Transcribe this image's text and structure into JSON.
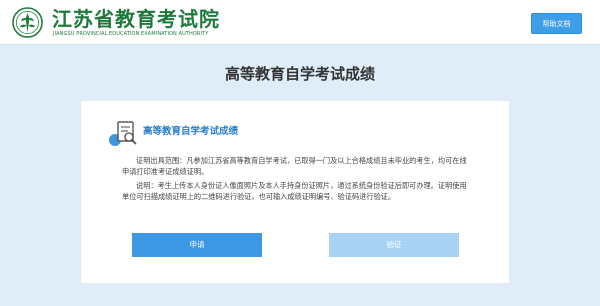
{
  "header": {
    "title": "江苏省教育考试院",
    "subtitle": "JIANGSU PROVINCIAL EDUCATION EXAMINATION AUTHORITY",
    "help_label": "帮助文档"
  },
  "page": {
    "title": "高等教育自学考试成绩"
  },
  "card": {
    "title": "高等教育自学考试成绩",
    "scope_text": "证明出具范围：凡参加江苏省高等教育自学考试，已取得一门及以上合格成绩且未毕业的考生，均可在线申请打印准考证成绩证明。",
    "note_text": "说明：考生上传本人身份证人像面照片及本人手持身份证照片，通过系统身份验证后即可办理。证明使用单位可扫描成绩证明上的二维码进行验证，也可输入成绩证明编号、验证码进行验证。"
  },
  "buttons": {
    "apply_label": "申请",
    "verify_label": "验证"
  },
  "colors": {
    "brand_green": "#1d7a3c",
    "accent_blue": "#3d97e2",
    "disabled_blue": "#a9d3f5",
    "background": "#deedf8"
  },
  "icons": {
    "logo": "emblem-logo-icon",
    "card_icon": "document-search-icon"
  }
}
